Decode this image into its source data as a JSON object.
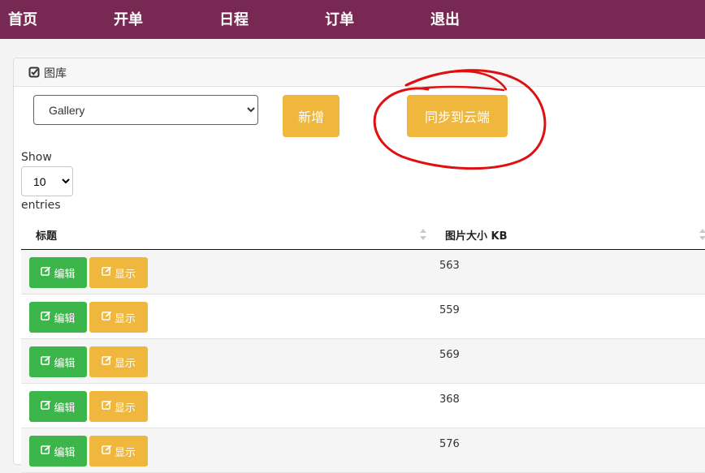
{
  "nav": {
    "items": [
      "首页",
      "开单",
      "日程",
      "订单",
      "退出"
    ]
  },
  "panel": {
    "title": "图库"
  },
  "gallery_select": {
    "value": "Gallery"
  },
  "buttons": {
    "add": "新增",
    "sync": "同步到云端"
  },
  "entries": {
    "show": "Show",
    "value": "10",
    "suffix": "entries"
  },
  "table": {
    "headers": {
      "title": "标题",
      "size": "图片大小 KB"
    },
    "rows": [
      {
        "edit": "编辑",
        "show": "显示",
        "size": "563"
      },
      {
        "edit": "编辑",
        "show": "显示",
        "size": "559"
      },
      {
        "edit": "编辑",
        "show": "显示",
        "size": "569"
      },
      {
        "edit": "编辑",
        "show": "显示",
        "size": "368"
      },
      {
        "edit": "编辑",
        "show": "显示",
        "size": "576"
      }
    ]
  },
  "colors": {
    "navbar": "#772953",
    "warning": "#efb73e",
    "success": "#3cb54a",
    "annotation": "#e01010"
  },
  "icons": {
    "panel": "check-square-icon",
    "edit": "edit-icon",
    "show": "edit-icon"
  }
}
